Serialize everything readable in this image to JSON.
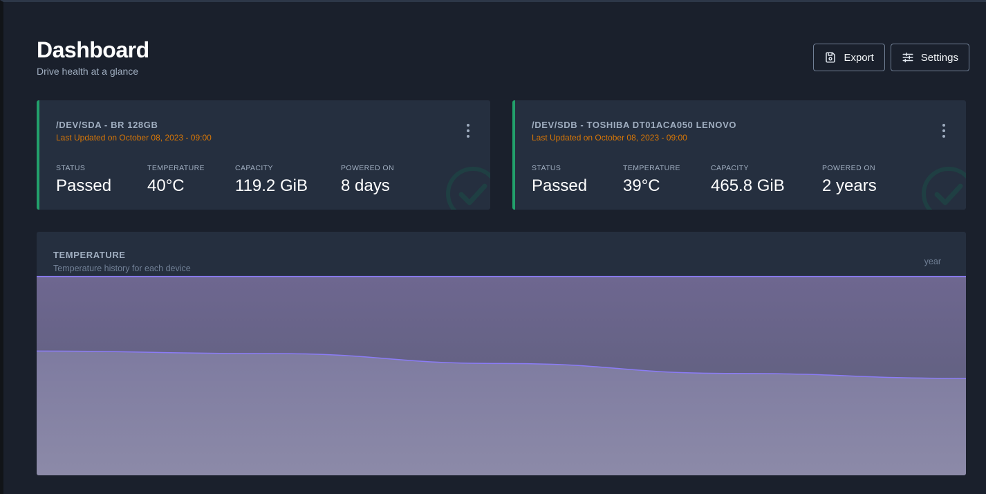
{
  "header": {
    "title": "Dashboard",
    "subtitle": "Drive health at a glance",
    "export_label": "Export",
    "settings_label": "Settings"
  },
  "devices": [
    {
      "title": "/DEV/SDA - BR 128GB",
      "updated": "Last Updated on October 08, 2023 - 09:00",
      "status_label": "STATUS",
      "status": "Passed",
      "temperature_label": "TEMPERATURE",
      "temperature": "40°C",
      "capacity_label": "CAPACITY",
      "capacity": "119.2 GiB",
      "powered_label": "POWERED ON",
      "powered": "8 days"
    },
    {
      "title": "/DEV/SDB - TOSHIBA DT01ACA050 LENOVO",
      "updated": "Last Updated on October 08, 2023 - 09:00",
      "status_label": "STATUS",
      "status": "Passed",
      "temperature_label": "TEMPERATURE",
      "temperature": "39°C",
      "capacity_label": "CAPACITY",
      "capacity": "465.8 GiB",
      "powered_label": "POWERED ON",
      "powered": "2 years"
    }
  ],
  "chart": {
    "title": "TEMPERATURE",
    "subtitle": "Temperature history for each device",
    "range": "year"
  },
  "colors": {
    "accent_green": "#22a06b",
    "updated_orange": "#d97706",
    "series_purple": "#8b7cf6"
  },
  "chart_data": {
    "type": "area",
    "x": [
      0,
      0.25,
      0.5,
      0.75,
      1
    ],
    "series": [
      {
        "values": [
          40,
          40,
          40,
          40,
          40
        ]
      },
      {
        "values": [
          25,
          24.5,
          22.5,
          20.5,
          19.5
        ]
      }
    ],
    "ylim": [
      0,
      49
    ],
    "grid": false,
    "legend": "none"
  }
}
